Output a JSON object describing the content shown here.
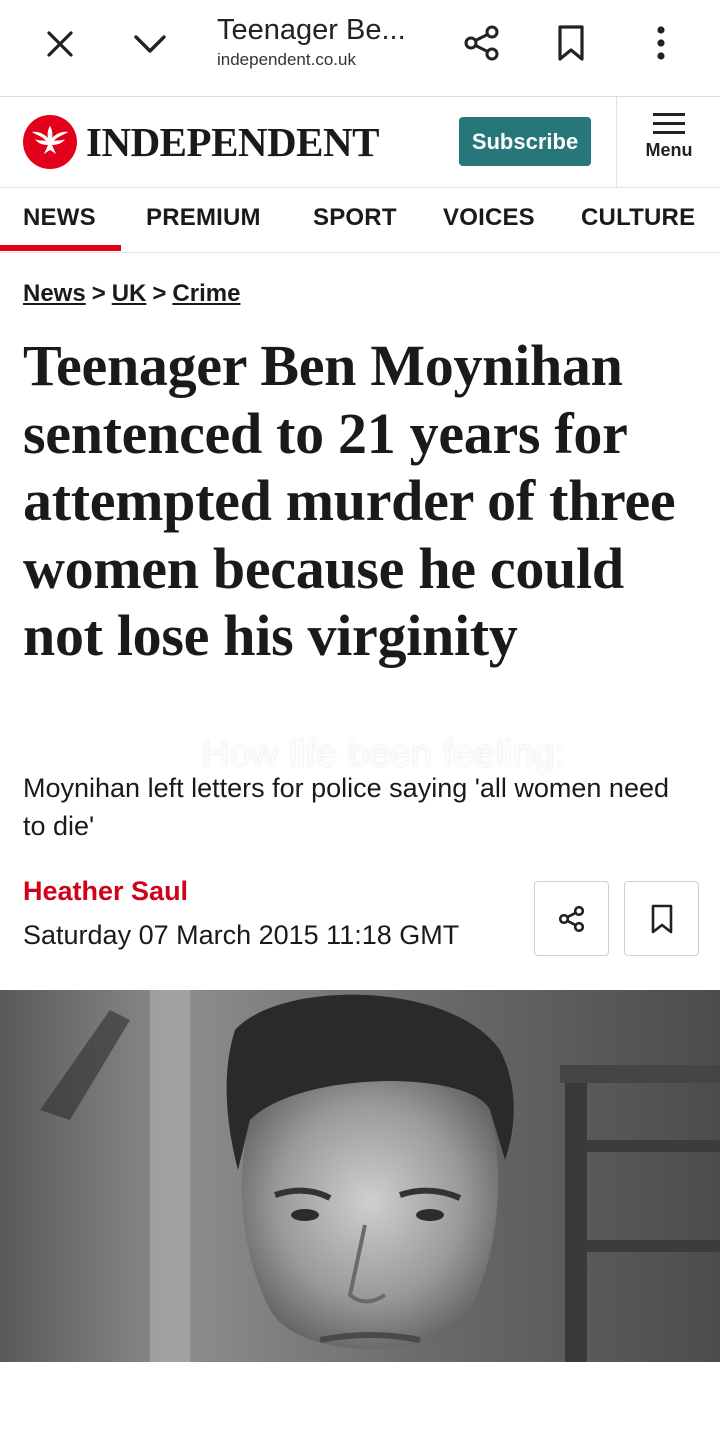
{
  "browser": {
    "tab_title": "Teenager Be...",
    "url": "independent.co.uk"
  },
  "site": {
    "logo_text": "INDEPENDENT",
    "subscribe_label": "Subscribe",
    "menu_label": "Menu"
  },
  "nav": {
    "items": [
      "NEWS",
      "PREMIUM",
      "SPORT",
      "VOICES",
      "CULTURE"
    ],
    "active": "NEWS",
    "accent_color": "#e2001a"
  },
  "breadcrumb": [
    "News",
    "UK",
    "Crime"
  ],
  "article": {
    "headline": "Teenager Ben Moynihan sentenced to 21 years for attempted murder of three women because he could not lose his virginity",
    "standfirst": "Moynihan left letters for police saying 'all women need to die'",
    "author": "Heather Saul",
    "date": "Saturday 07 March 2015 11:18 GMT"
  },
  "overlay_caption": "How life been feeling:",
  "colors": {
    "subscribe_bg": "#26767a",
    "author": "#d0021b"
  },
  "icons": [
    "close-icon",
    "chevron-down-icon",
    "share-icon",
    "bookmark-icon",
    "more-vert-icon",
    "independent-eagle-logo",
    "menu-icon"
  ]
}
